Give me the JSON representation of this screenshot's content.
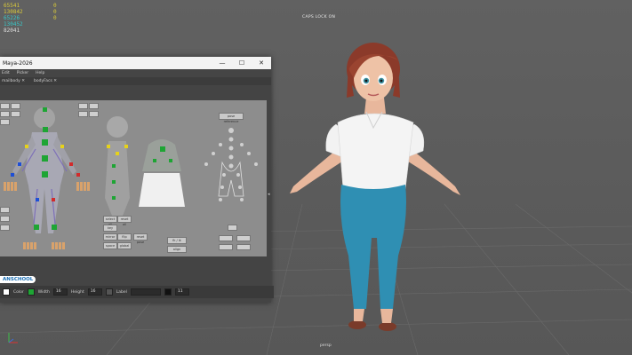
{
  "hud": {
    "lines": [
      {
        "label": "Verts:",
        "value": "65541",
        "color": "yellow"
      },
      {
        "label": "Edges:",
        "value": "130842",
        "color": "yellow"
      },
      {
        "label": "Faces:",
        "value": "65226",
        "color": "cyan"
      },
      {
        "label": "Tris:",
        "value": "130452",
        "color": "cyan"
      },
      {
        "label": "UVs:",
        "value": "82041",
        "color": "white"
      }
    ],
    "side_values": [
      "0",
      "0",
      "0",
      "0",
      "0"
    ]
  },
  "viewport": {
    "caps_lock": "CAPS LOCK ON",
    "camera": "persp"
  },
  "window": {
    "title": "Maya-2026",
    "controls": {
      "minimize": "—",
      "maximize": "☐",
      "close": "✕"
    },
    "menu": [
      "Edit",
      "Picker",
      "Help"
    ],
    "tabs": [
      "mailbody ✕",
      "bodyFacs ✕"
    ],
    "panel_buttons": {
      "select_all": "select all",
      "reset_all": "reset all",
      "key": "key",
      "pose_reference": "pose reference",
      "mirror": "mirror",
      "flip": "flip",
      "reset_pose": "reset pose",
      "fk_ik": "fk / ik",
      "align_ik_fk": "align",
      "space": "space",
      "global": "global"
    },
    "bottom": {
      "color_label": "Color",
      "width_label": "Width",
      "width_value": "16",
      "height_label": "Height",
      "height_value": "16",
      "label_label": "Label",
      "label_value": "",
      "extra_value": "11"
    }
  },
  "badge": "ANSCHOOL",
  "colors": {
    "green": "#1ea534",
    "yellow": "#e6d21a",
    "blue": "#1e4fd6",
    "red": "#d22b2b",
    "tan": "#d9a26b",
    "shirt": "#f2f2f2",
    "jeans": "#2f8fb3"
  }
}
